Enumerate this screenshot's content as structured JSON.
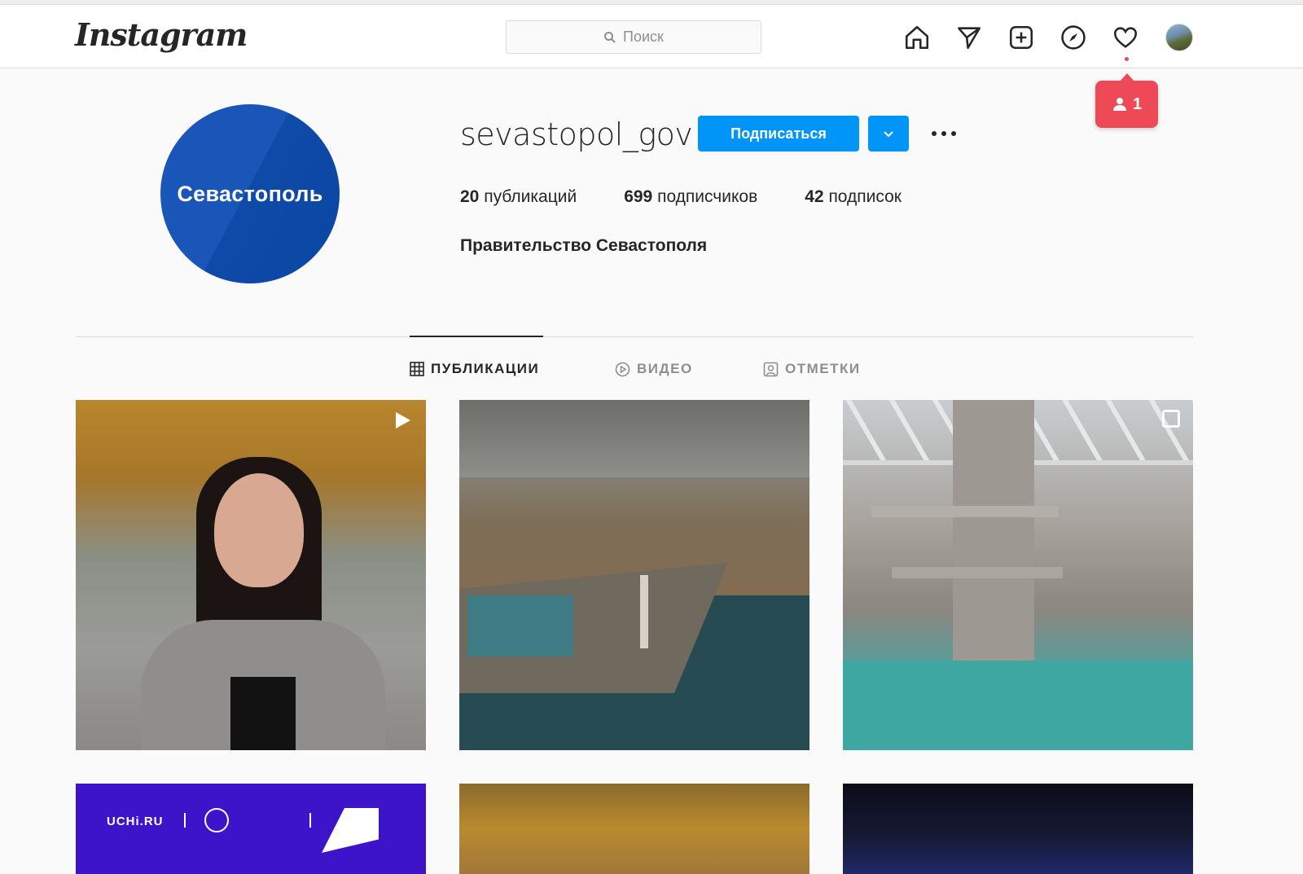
{
  "app": {
    "logo_text": "Instagram"
  },
  "header": {
    "search_placeholder": "Поиск",
    "nav_icons": [
      "home-icon",
      "direct-icon",
      "new-post-icon",
      "explore-icon",
      "activity-icon",
      "profile-avatar"
    ],
    "notification_count": "1",
    "accent_color": "#ed4956"
  },
  "profile": {
    "avatar_text": "Севастополь",
    "username": "sevastopol_gov",
    "follow_label": "Подписаться",
    "posts_count": "20",
    "posts_label": "публикаций",
    "followers_count": "699",
    "followers_label": "подписчиков",
    "following_count": "42",
    "following_label": "подписок",
    "full_name": "Правительство Севастополя",
    "brand_color": "#0095f6"
  },
  "tabs": [
    {
      "label": "ПУБЛИКАЦИИ",
      "icon": "grid-icon",
      "active": true
    },
    {
      "label": "ВИДЕО",
      "icon": "video-icon",
      "active": false
    },
    {
      "label": "ОТМЕТКИ",
      "icon": "tagged-icon",
      "active": false
    }
  ],
  "posts": {
    "uchi_brand": "UCHi.RU"
  }
}
